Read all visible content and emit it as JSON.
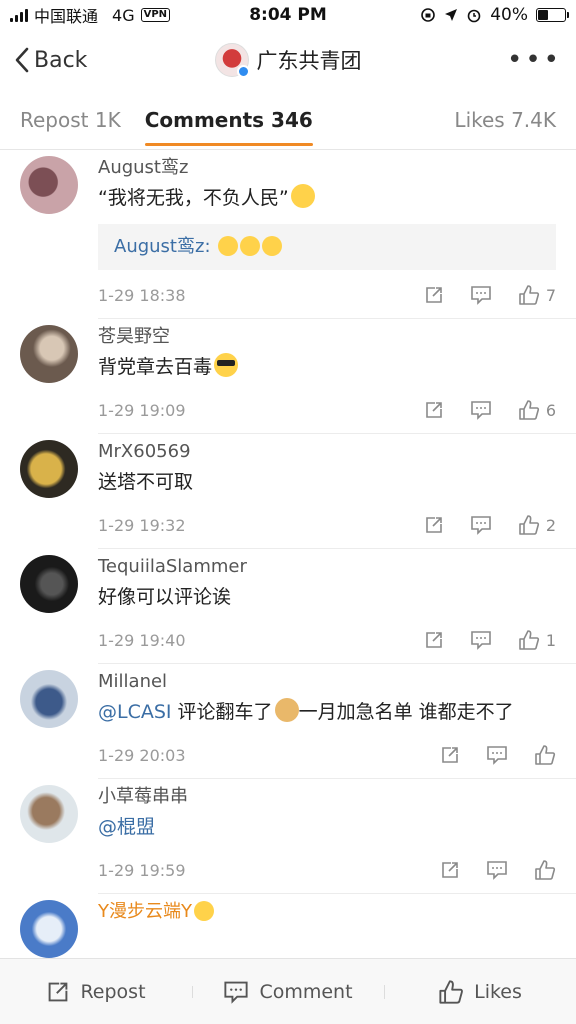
{
  "status_bar": {
    "carrier": "中国联通",
    "network": "4G",
    "vpn": "VPN",
    "time": "8:04 PM",
    "battery_percent": "40%",
    "battery_level": 0.4
  },
  "nav": {
    "back_label": "Back",
    "title": "广东共青团",
    "more_label": "•••"
  },
  "tabs": {
    "repost": "Repost 1K",
    "comments": "Comments 346",
    "likes": "Likes 7.4K"
  },
  "comments": [
    {
      "user": "August鸾z",
      "text": "“我将无我，不负人民”",
      "reply_user": "August鸾z:",
      "date": "1-29 18:38",
      "likes": "7",
      "avatar_colors": [
        "#c9a3a8",
        "#7c4f55"
      ]
    },
    {
      "user": "苍昊野空",
      "text": "背党章去百毒",
      "date": "1-29 19:09",
      "likes": "6",
      "avatar_colors": [
        "#6b5a4e",
        "#d8c7b5"
      ]
    },
    {
      "user": "MrX60569",
      "text": "送塔不可取",
      "date": "1-29 19:32",
      "likes": "2",
      "avatar_colors": [
        "#2e2a22",
        "#d9b24a"
      ]
    },
    {
      "user": "TequiilaSlammer",
      "text": "好像可以评论诶",
      "date": "1-29 19:40",
      "likes": "1",
      "avatar_colors": [
        "#1a1a1a",
        "#555555"
      ]
    },
    {
      "user": "Millanel",
      "mention": "@LCASI",
      "text": " 评论翻车了",
      "text2": "一月加急名单 谁都走不了",
      "date": "1-29 20:03",
      "likes": "",
      "avatar_colors": [
        "#3d5a8a",
        "#c8d3e0"
      ]
    },
    {
      "user": "小草莓串串",
      "mention": "@棍盟",
      "date": "1-29 19:59",
      "likes": "",
      "avatar_colors": [
        "#9a7a5f",
        "#dfe6ea"
      ]
    },
    {
      "user": "Y漫步云端Y",
      "avatar_colors": [
        "#4a7bc8",
        "#e6eef8"
      ]
    }
  ],
  "bottom_bar": {
    "repost": "Repost",
    "comment": "Comment",
    "likes": "Likes"
  }
}
